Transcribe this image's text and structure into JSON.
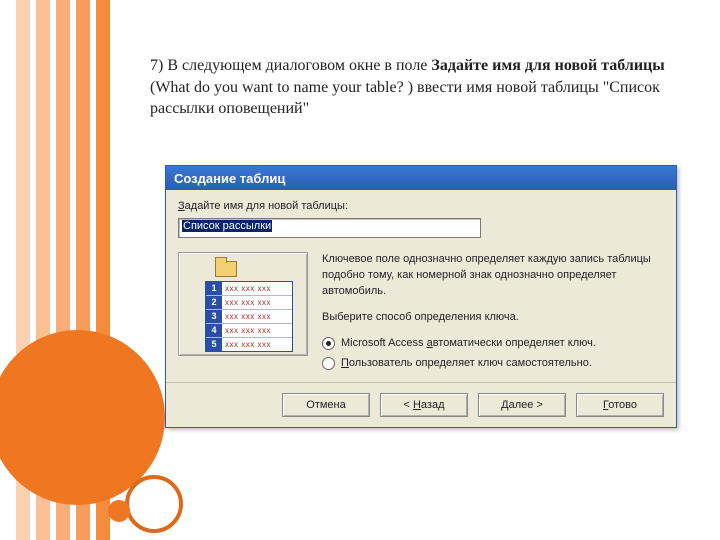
{
  "slide": {
    "text_plain_prefix": "7) В следующем диалоговом окне в поле ",
    "text_bold_1": "Задайте имя для новой таблицы",
    "text_mid": " (What do you want to name your table? ) ввести имя новой таблицы \"Список рассылки оповещений\""
  },
  "dialog": {
    "title": "Создание таблиц",
    "prompt": "Задайте имя для новой таблицы:",
    "input_value": "Список рассылки",
    "info_p1": "Ключевое поле однозначно определяет каждую запись таблицы подобно тому, как номерной знак однозначно определяет автомобиль.",
    "info_p2": "Выберите способ определения ключа.",
    "radio1": "Microsoft Access автоматически определяет ключ.",
    "radio2": "Пользователь определяет ключ самостоятельно.",
    "buttons": {
      "cancel": "Отмена",
      "back": "< Назад",
      "next": "Далее >",
      "finish": "Готово"
    },
    "illus_rows": [
      "1",
      "2",
      "3",
      "4",
      "5"
    ],
    "illus_cell_text": "xxx xxx xxx"
  }
}
